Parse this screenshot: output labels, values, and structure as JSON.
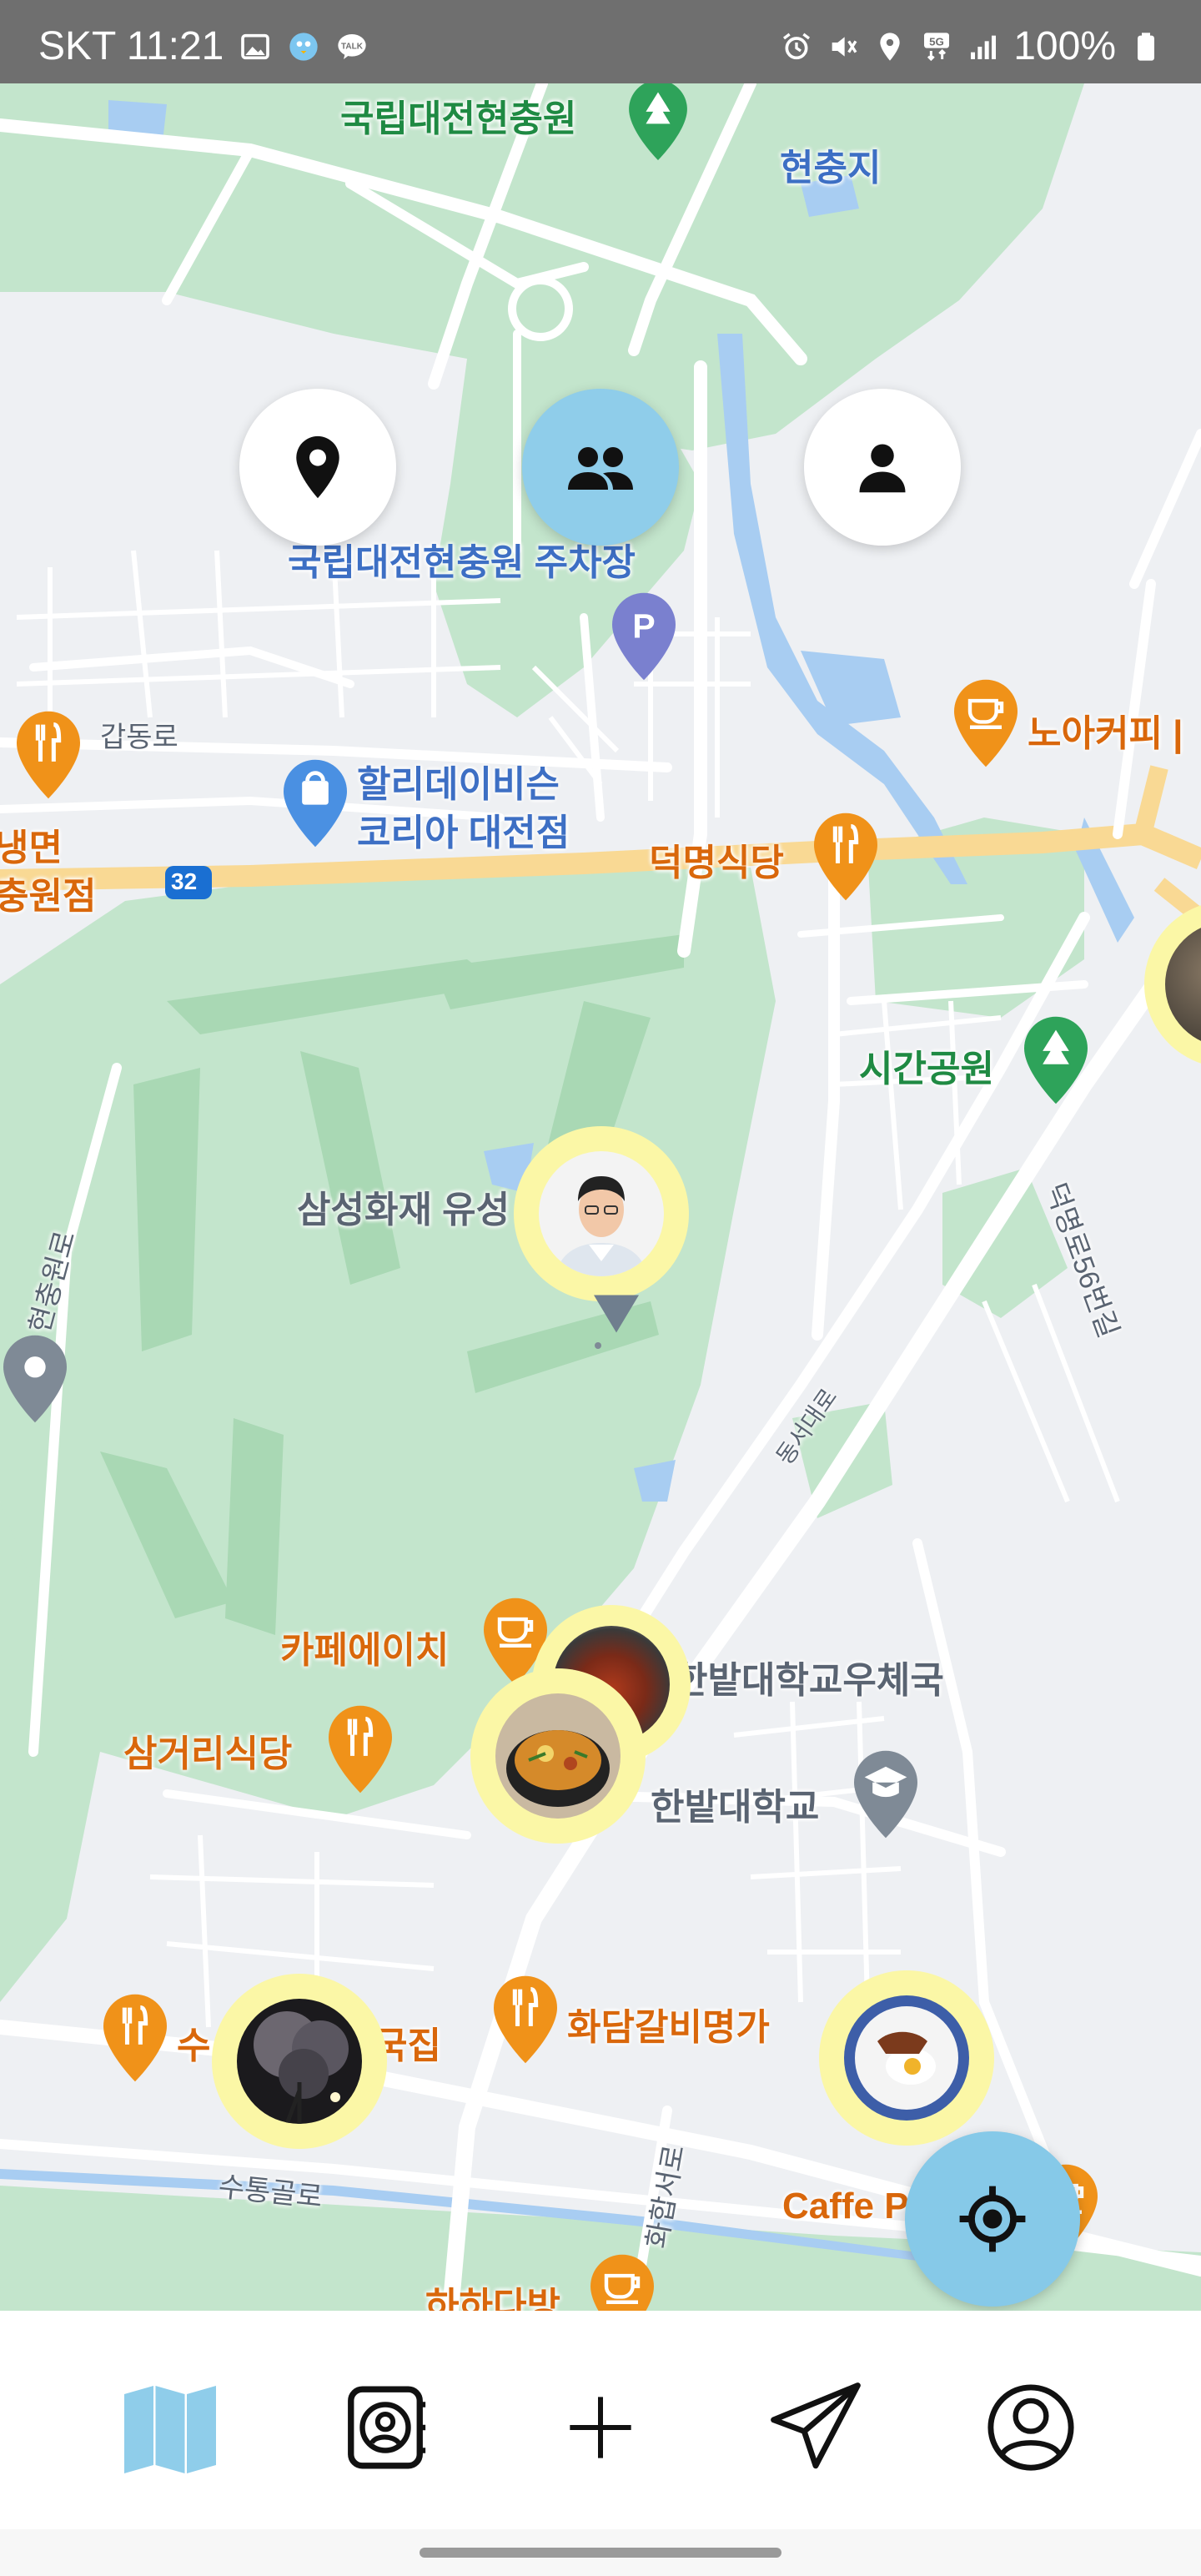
{
  "status_bar": {
    "carrier_time": "SKT 11:21",
    "battery": "100%",
    "network": "5G"
  },
  "map": {
    "labels": {
      "cemetery": "국립대전현충원",
      "hyeonchungji": "현충지",
      "parking": "국립대전현충원 주차장",
      "gapdongro": "갑동로",
      "hollys": "할리데이비슨\n코리아 대전점",
      "hollys_line1": "할리데이비슨",
      "hollys_line2": "코리아 대전점",
      "naengmyeon_line1": "냉면",
      "naengmyeon_line2": "충원점",
      "route_32": "32",
      "deokmyeong": "덕명식당",
      "noah_cafe": "노아커피 |",
      "sigan_park": "시간공원",
      "samsung": "삼성화재 유성",
      "hyeonchungwonro": "현충원로",
      "deokmyeongro56": "덕명로56번길",
      "dongseodaero": "동서대로",
      "cafe_h": "카페에이치",
      "hanbat_post": "한밭대학교우체국",
      "samgeori": "삼거리식당",
      "hanbat_univ": "한밭대학교",
      "su_left": "수",
      "su_right": "국집",
      "hwadam": "화담갈비명가",
      "sutonggolro": "수통골로",
      "hwahapseoro": "화합서로",
      "caffe_paseo": "Caffe Paseo",
      "hahadabang": "하하다방"
    }
  },
  "mode_buttons": [
    {
      "name": "places",
      "icon": "location-pin-icon",
      "active": false
    },
    {
      "name": "friends",
      "icon": "group-icon",
      "active": true
    },
    {
      "name": "me",
      "icon": "person-icon",
      "active": false
    }
  ],
  "colors": {
    "accent": "#8fcdea",
    "photo_ring": "#fbf7a6",
    "park_green": "#c3e5cc",
    "water": "#a8cdf2",
    "road": "#ffffff",
    "highway": "#f9d994"
  },
  "bottom_nav": [
    {
      "name": "map",
      "icon": "map-icon",
      "active": true
    },
    {
      "name": "contacts",
      "icon": "contact-book-icon",
      "active": false
    },
    {
      "name": "add",
      "icon": "plus-icon",
      "active": false
    },
    {
      "name": "share",
      "icon": "paper-plane-icon",
      "active": false
    },
    {
      "name": "profile",
      "icon": "profile-icon",
      "active": false
    }
  ]
}
